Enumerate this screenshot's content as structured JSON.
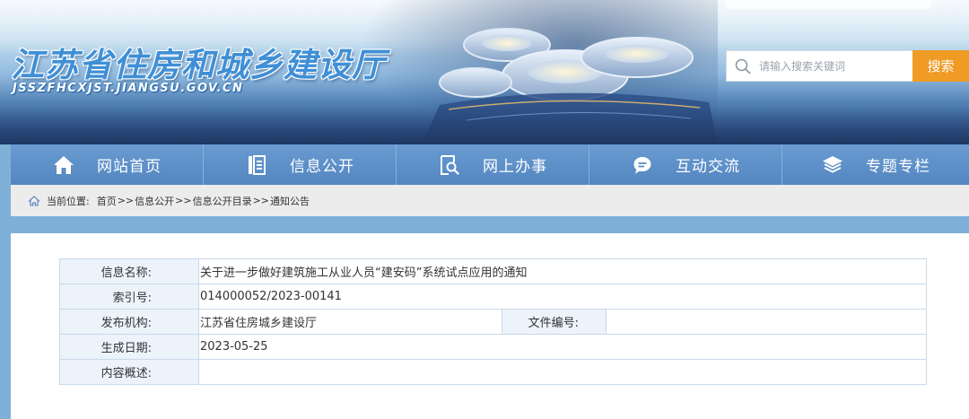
{
  "header": {
    "site_title": "江苏省住房和城乡建设厅",
    "site_domain": "JSSZFHCXJST.JIANGSU.GOV.CN"
  },
  "search": {
    "placeholder": "请输入搜索关键词",
    "value": "",
    "button_label": "搜索"
  },
  "nav": {
    "items": [
      {
        "label": "网站首页",
        "icon": "home-icon"
      },
      {
        "label": "信息公开",
        "icon": "document-icon"
      },
      {
        "label": "网上办事",
        "icon": "search-document-icon"
      },
      {
        "label": "互动交流",
        "icon": "chat-bubble-icon"
      },
      {
        "label": "专题专栏",
        "icon": "layers-icon"
      }
    ]
  },
  "breadcrumb": {
    "prefix": "当前位置:",
    "items": [
      "首页",
      "信息公开",
      "信息公开目录",
      "通知公告"
    ],
    "separator": ">>"
  },
  "info": {
    "name_label": "信息名称:",
    "name_value": "关于进一步做好建筑施工从业人员“建安码”系统试点应用的通知",
    "index_label": "索引号:",
    "index_value": "014000052/2023-00141",
    "publisher_label": "发布机构:",
    "publisher_value": "江苏省住房城乡建设厅",
    "docno_label": "文件编号:",
    "docno_value": "",
    "date_label": "生成日期:",
    "date_value": "2023-05-25",
    "summary_label": "内容概述:",
    "summary_value": ""
  },
  "colors": {
    "nav_blue": "#5b8dc6",
    "search_orange": "#ef9b24",
    "table_label_bg": "#ecf3fb",
    "table_border": "#c9d8ea"
  }
}
